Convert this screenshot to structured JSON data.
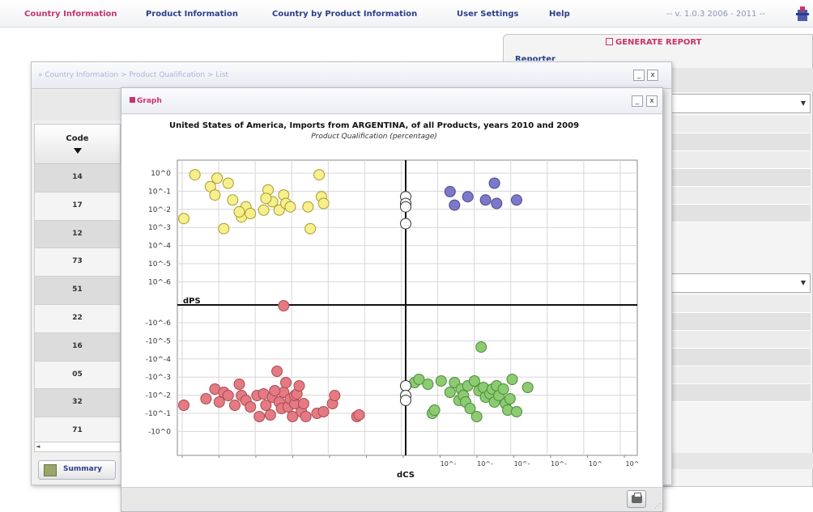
{
  "menu": {
    "items": [
      {
        "label": "Country Information",
        "active": true
      },
      {
        "label": "Product Information",
        "active": false
      },
      {
        "label": "Country by Product Information",
        "active": false
      },
      {
        "label": "User Settings",
        "active": false
      },
      {
        "label": "Help",
        "active": false
      }
    ],
    "version": "-- v. 1.0.3 2006 - 2011 --"
  },
  "side_panel": {
    "generate_report": "GENERATE REPORT",
    "reporter_label": "Reporter"
  },
  "list_window": {
    "title": "» Country Information > Product Qualification > List",
    "code_header": "Code",
    "codes": [
      "14",
      "17",
      "12",
      "73",
      "51",
      "22",
      "16",
      "05",
      "32",
      "71"
    ],
    "summary_button": "Summary"
  },
  "graph_window": {
    "title": "Graph",
    "minimize": "_",
    "close": "x"
  },
  "colors": {
    "menu_text": "#2a3f8c",
    "accent": "#c8336b",
    "q1_yellow": "#f6ef8c",
    "q2_purple": "#7b79c8",
    "q3_red": "#e57a82",
    "q4_green": "#8ccb72"
  },
  "chart_data": {
    "type": "scatter",
    "title": "United States of America, Imports from ARGENTINA, of all Products, years 2010 and 2009",
    "subtitle": "Product Qualification (percentage)",
    "xlabel": "dCS",
    "ylabel": "dPS",
    "y_ticks_positive": [
      "10^0",
      "10^-1",
      "10^-2",
      "10^-3",
      "10^-4",
      "10^-5",
      "10^-6"
    ],
    "y_ticks_negative": [
      "-10^-6",
      "-10^-5",
      "-10^-4",
      "-10^-3",
      "-10^-2",
      "-10^-1",
      "-10^0"
    ],
    "x_ticks": [
      "",
      "",
      "",
      "",
      "",
      "",
      "",
      "10^-",
      "10^-",
      "10^-",
      "10^-",
      "10^",
      "10^"
    ],
    "scale": "symmetric log (decades from 10^-6 to 10^0)",
    "grid": true,
    "series": [
      {
        "quadrant": "upper-left",
        "color": "yellow",
        "points": [
          [
            -1.0,
            -2.7
          ],
          [
            -0.95,
            -0.1
          ],
          [
            -0.85,
            -0.3
          ],
          [
            -0.88,
            -0.8
          ],
          [
            -0.8,
            -0.6
          ],
          [
            -0.78,
            -1.6
          ],
          [
            -0.72,
            -2.0
          ],
          [
            -0.74,
            -2.6
          ],
          [
            -0.86,
            -1.3
          ],
          [
            -0.75,
            -2.3
          ],
          [
            -0.82,
            -3.3
          ],
          [
            -0.7,
            -2.4
          ],
          [
            -0.62,
            -1.0
          ],
          [
            -0.6,
            -1.7
          ],
          [
            -0.57,
            -2.2
          ],
          [
            -0.55,
            -1.3
          ],
          [
            -0.54,
            -1.8
          ],
          [
            -0.52,
            -2.0
          ],
          [
            -0.44,
            -2.0
          ],
          [
            -0.43,
            -3.3
          ],
          [
            -0.39,
            -0.1
          ],
          [
            -0.38,
            -1.4
          ],
          [
            -0.37,
            -1.8
          ],
          [
            -0.64,
            -2.2
          ],
          [
            -0.63,
            -1.5
          ]
        ]
      },
      {
        "quadrant": "upper-right",
        "color": "purple",
        "points": [
          [
            0.2,
            -1.1
          ],
          [
            0.22,
            -1.9
          ],
          [
            0.28,
            -1.4
          ],
          [
            0.36,
            -1.6
          ],
          [
            0.4,
            -0.6
          ],
          [
            0.41,
            -1.8
          ],
          [
            0.5,
            -1.6
          ]
        ]
      },
      {
        "quadrant": "lower-left",
        "color": "red",
        "points": [
          [
            -0.55,
            -0.02
          ],
          [
            -1.0,
            -5.6
          ],
          [
            -0.9,
            -5.2
          ],
          [
            -0.86,
            -4.6
          ],
          [
            -0.84,
            -5.4
          ],
          [
            -0.82,
            -4.8
          ],
          [
            -0.8,
            -5.0
          ],
          [
            -0.77,
            -5.6
          ],
          [
            -0.75,
            -4.3
          ],
          [
            -0.74,
            -5.0
          ],
          [
            -0.72,
            -5.3
          ],
          [
            -0.7,
            -5.7
          ],
          [
            -0.67,
            -5.0
          ],
          [
            -0.66,
            -6.3
          ],
          [
            -0.64,
            -4.9
          ],
          [
            -0.63,
            -5.6
          ],
          [
            -0.61,
            -6.2
          ],
          [
            -0.6,
            -5.1
          ],
          [
            -0.58,
            -3.5
          ],
          [
            -0.57,
            -5.4
          ],
          [
            -0.56,
            -5.8
          ],
          [
            -0.55,
            -4.8
          ],
          [
            -0.54,
            -4.2
          ],
          [
            -0.53,
            -5.7
          ],
          [
            -0.52,
            -5.2
          ],
          [
            -0.51,
            -6.3
          ],
          [
            -0.5,
            -5.5
          ],
          [
            -0.5,
            -5.0
          ],
          [
            -0.49,
            -4.9
          ],
          [
            -0.48,
            -4.4
          ],
          [
            -0.47,
            -6.0
          ],
          [
            -0.46,
            -5.5
          ],
          [
            -0.4,
            -6.1
          ],
          [
            -0.37,
            -6.0
          ],
          [
            -0.33,
            -5.5
          ],
          [
            -0.32,
            -5.0
          ],
          [
            -0.22,
            -6.3
          ],
          [
            -0.21,
            -6.2
          ],
          [
            -0.45,
            -6.3
          ],
          [
            -0.59,
            -4.7
          ]
        ]
      },
      {
        "quadrant": "lower-right",
        "color": "green",
        "points": [
          [
            0.04,
            -4.2
          ],
          [
            0.06,
            -4.0
          ],
          [
            0.1,
            -4.3
          ],
          [
            0.12,
            -6.1
          ],
          [
            0.13,
            -5.9
          ],
          [
            0.16,
            -4.1
          ],
          [
            0.2,
            -4.8
          ],
          [
            0.22,
            -4.2
          ],
          [
            0.24,
            -5.3
          ],
          [
            0.25,
            -4.6
          ],
          [
            0.26,
            -5.0
          ],
          [
            0.27,
            -5.4
          ],
          [
            0.28,
            -4.4
          ],
          [
            0.29,
            -5.8
          ],
          [
            0.31,
            -4.1
          ],
          [
            0.32,
            -6.3
          ],
          [
            0.33,
            -4.7
          ],
          [
            0.34,
            -2.0
          ],
          [
            0.35,
            -4.5
          ],
          [
            0.36,
            -5.1
          ],
          [
            0.38,
            -4.9
          ],
          [
            0.39,
            -4.6
          ],
          [
            0.4,
            -5.4
          ],
          [
            0.41,
            -4.4
          ],
          [
            0.42,
            -5.0
          ],
          [
            0.44,
            -4.6
          ],
          [
            0.45,
            -5.5
          ],
          [
            0.46,
            -5.9
          ],
          [
            0.47,
            -5.2
          ],
          [
            0.48,
            -4.0
          ],
          [
            0.5,
            -6.0
          ],
          [
            0.55,
            -4.5
          ]
        ]
      },
      {
        "quadrant": "axis",
        "color": "white",
        "points": [
          [
            0.0,
            -1.4
          ],
          [
            0.0,
            -1.8
          ],
          [
            0.0,
            -2.0
          ],
          [
            0.0,
            -3.0
          ],
          [
            0.0,
            -4.4
          ],
          [
            0.0,
            -5.0
          ],
          [
            0.0,
            -5.3
          ]
        ]
      }
    ]
  }
}
